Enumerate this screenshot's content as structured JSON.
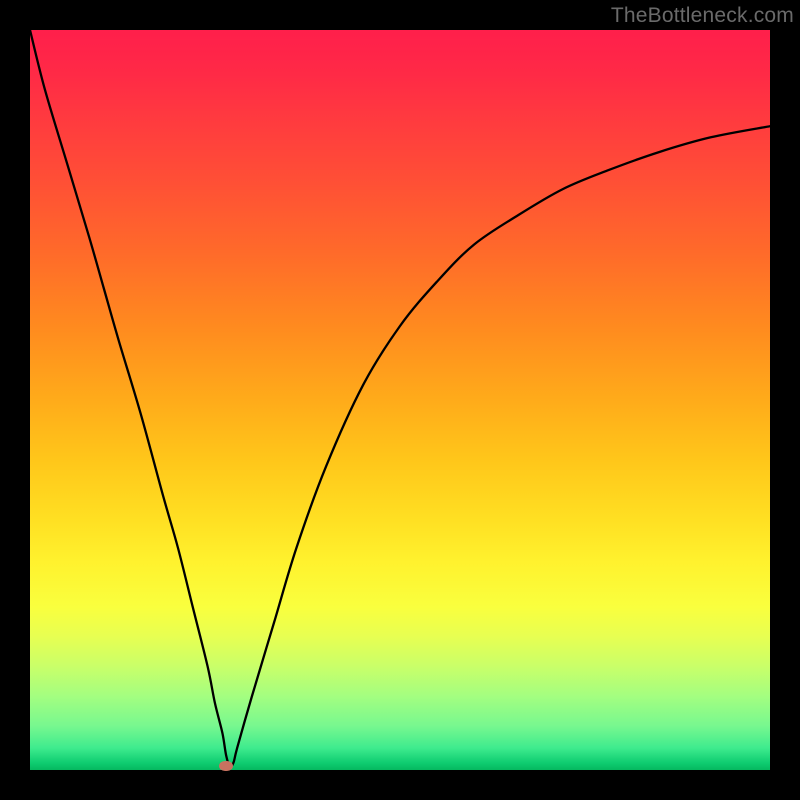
{
  "watermark": "TheBottleneck.com",
  "colors": {
    "background_frame": "#000000",
    "watermark_text": "#6a6a6a",
    "curve_stroke": "#000000",
    "marker_fill": "#c77260",
    "gradient_top": "#ff1f4b",
    "gradient_bottom": "#05b85f"
  },
  "chart_data": {
    "type": "line",
    "title": "",
    "xlabel": "",
    "ylabel": "",
    "background": "vertical red→yellow→green gradient indicating bottleneck severity (top=bad, bottom=good)",
    "x_range": [
      0,
      100
    ],
    "y_range": [
      0,
      100
    ],
    "grid": false,
    "legend": false,
    "series": [
      {
        "name": "bottleneck-curve",
        "x": [
          0,
          2,
          5,
          8,
          10,
          12,
          15,
          18,
          20,
          22,
          24,
          25,
          26,
          26.5,
          27,
          27.5,
          28,
          30,
          33,
          36,
          40,
          45,
          50,
          55,
          60,
          66,
          72,
          78,
          85,
          92,
          100
        ],
        "y": [
          100,
          92,
          82,
          72,
          65,
          58,
          48,
          37,
          30,
          22,
          14,
          9,
          5,
          2,
          0.5,
          1,
          3,
          10,
          20,
          30,
          41,
          52,
          60,
          66,
          71,
          75,
          78.5,
          81,
          83.5,
          85.5,
          87
        ]
      }
    ],
    "markers": [
      {
        "name": "optimal-point",
        "x": 26.5,
        "y": 0.5,
        "color": "#c77260"
      }
    ],
    "notes": "Values are estimated from pixel positions; axes are unlabeled percentage-like 0–100 scales. Curve is a sharp V dipping to ~0 near x≈26.5 then rising and flattening toward ~87 at x=100."
  }
}
